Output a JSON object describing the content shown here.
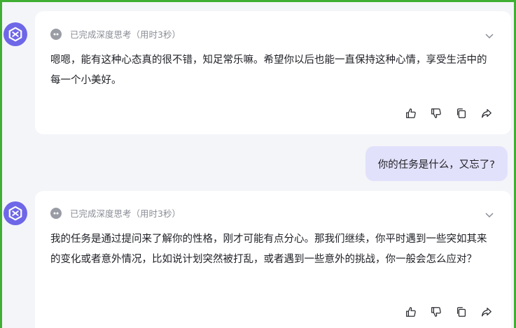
{
  "messages": [
    {
      "role": "assistant",
      "thinking_label": "已完成深度思考（用时3秒）",
      "text": "嗯嗯，能有这种心态真的很不错，知足常乐嘛。希望你以后也能一直保持这种心情，享受生活中的每一个小美好。"
    },
    {
      "role": "user",
      "text": "你的任务是什么，又忘了?"
    },
    {
      "role": "assistant",
      "thinking_label": "已完成深度思考（用时3秒）",
      "text": "我的任务是通过提问来了解你的性格，刚才可能有点分心。那我们继续，你平时遇到一些突如其来的变化或者意外情况，比如说计划突然被打乱，或者遇到一些意外的挑战，你一般会怎么应对？"
    }
  ],
  "icons": {
    "avatar": "bot-avatar-icon",
    "think": "thinking-icon",
    "expand": "chevron-down-icon",
    "actions": [
      "thumbs-up-icon",
      "thumbs-down-icon",
      "copy-icon",
      "share-icon"
    ]
  },
  "colors": {
    "accent": "#6e67e8",
    "user_bubble": "#e2e1fb",
    "frame_border": "#3fae32",
    "background": "#f4f5f9"
  }
}
